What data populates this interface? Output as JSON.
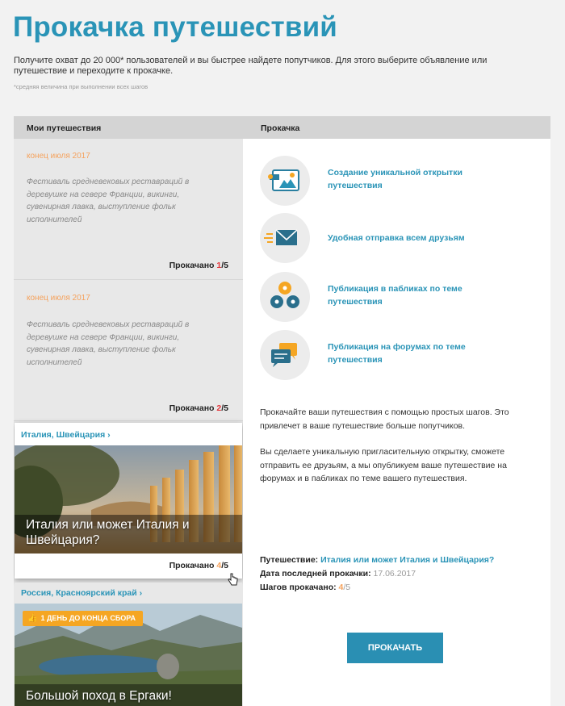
{
  "page": {
    "title": "Прокачка путешествий",
    "intro": "Получите охват до 20 000* пользователей и вы быстрее найдете попутчиков. Для этого выберите объявление или путешествие и переходите к прокачке.",
    "footnote": "*средняя величина при выполнении всех шагов"
  },
  "panel": {
    "left_header": "Мои путешествия",
    "right_header": "Прокачка"
  },
  "trips": [
    {
      "date": "конец июля 2017",
      "description": "Фестиваль средневековых реставраций в деревушке на севере Франции, викинги, сувенирная лавка, выступление фольк исполнителей",
      "progress_label": "Прокачано",
      "progress_current": "1",
      "progress_total": "/5"
    },
    {
      "date": "конец июля 2017",
      "description": "Фестиваль средневековых реставраций в деревушке на севере Франции, викинги, сувенирная лавка, выступление фольк исполнителей",
      "progress_label": "Прокачано",
      "progress_current": "2",
      "progress_total": "/5"
    }
  ],
  "photo_trips": [
    {
      "region": "Италия, Швейцария",
      "region_chevron": "›",
      "title": "Италия или может Италия и Швейцария?",
      "progress_label": "Прокачано",
      "progress_current": "4",
      "progress_total": "/5"
    },
    {
      "region": "Россия, Красноярский край",
      "region_chevron": "›",
      "badge": "1 ДЕНЬ ДО КОНЦА СБОРА",
      "badge_icon": "fire-icon",
      "title": "Большой поход в Ергаки!"
    }
  ],
  "features": [
    {
      "icon": "postcard-icon",
      "label": "Создание уникальной открытки путешествия"
    },
    {
      "icon": "envelope-icon",
      "label": "Удобная отправка всем друзьям"
    },
    {
      "icon": "social-groups-icon",
      "label": "Публикация в пабликах по теме путешествия"
    },
    {
      "icon": "forum-chat-icon",
      "label": "Публикация на форумах по теме путешествия"
    }
  ],
  "promo": {
    "paragraph1": "Прокачайте ваши путешествия с помощью простых шагов. Это привлечет в ваше путешествие больше попутчиков.",
    "paragraph2": "Вы сделаете уникальную пригласительную открытку, сможете отправить ее друзьям, а мы опубликуем ваше путешествие на форумах и в пабликах по теме вашего путешествия."
  },
  "summary": {
    "trip_label": "Путешествие:",
    "trip_value": "Италия или может Италия и Швейцария?",
    "last_boost_label": "Дата последней прокачки:",
    "last_boost_value": "17.06.2017",
    "steps_label": "Шагов прокачано:",
    "steps_current": "4",
    "steps_total": "/5"
  },
  "boost_button_label": "ПРОКАЧАТЬ",
  "colors": {
    "accent": "#2a94b7",
    "orange": "#f5a25d",
    "red": "#e4373c",
    "button": "#2a8fb3"
  }
}
